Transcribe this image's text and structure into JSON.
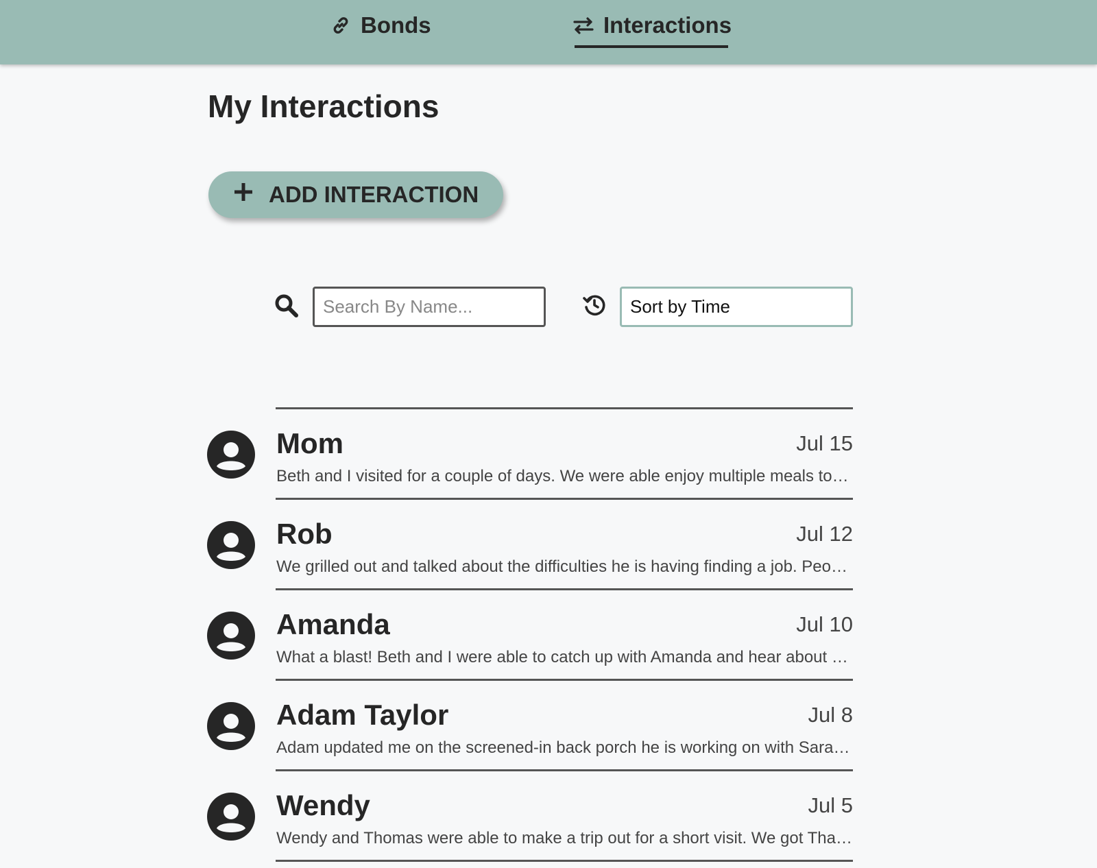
{
  "nav": {
    "tabs": [
      {
        "label": "Bonds",
        "icon": "link-icon",
        "active": false
      },
      {
        "label": "Interactions",
        "icon": "swap-arrows-icon",
        "active": true
      }
    ]
  },
  "page": {
    "title": "My Interactions",
    "add_button_label": "ADD INTERACTION"
  },
  "filters": {
    "search_placeholder": "Search By Name...",
    "search_value": "",
    "sort_selected": "Sort by Time"
  },
  "colors": {
    "accent": "#99bbb4",
    "text": "#262626",
    "background": "#f7f8f9"
  },
  "interactions": [
    {
      "name": "Mom",
      "date": "Jul 15",
      "text": "Beth and I visited for a couple of days. We were able enjoy multiple meals together and catch up"
    },
    {
      "name": "Rob",
      "date": "Jul 12",
      "text": "We grilled out and talked about the difficulties he is having finding a job. People just are not hiring"
    },
    {
      "name": "Amanda",
      "date": "Jul 10",
      "text": "What a blast! Beth and I were able to catch up with Amanda and hear about her new adventures"
    },
    {
      "name": "Adam Taylor",
      "date": "Jul 8",
      "text": "Adam updated me on the screened-in back porch he is working on with Sarah this summer"
    },
    {
      "name": "Wendy",
      "date": "Jul 5",
      "text": "Wendy and Thomas were able to make a trip out for a short visit. We got Thai food together"
    }
  ]
}
